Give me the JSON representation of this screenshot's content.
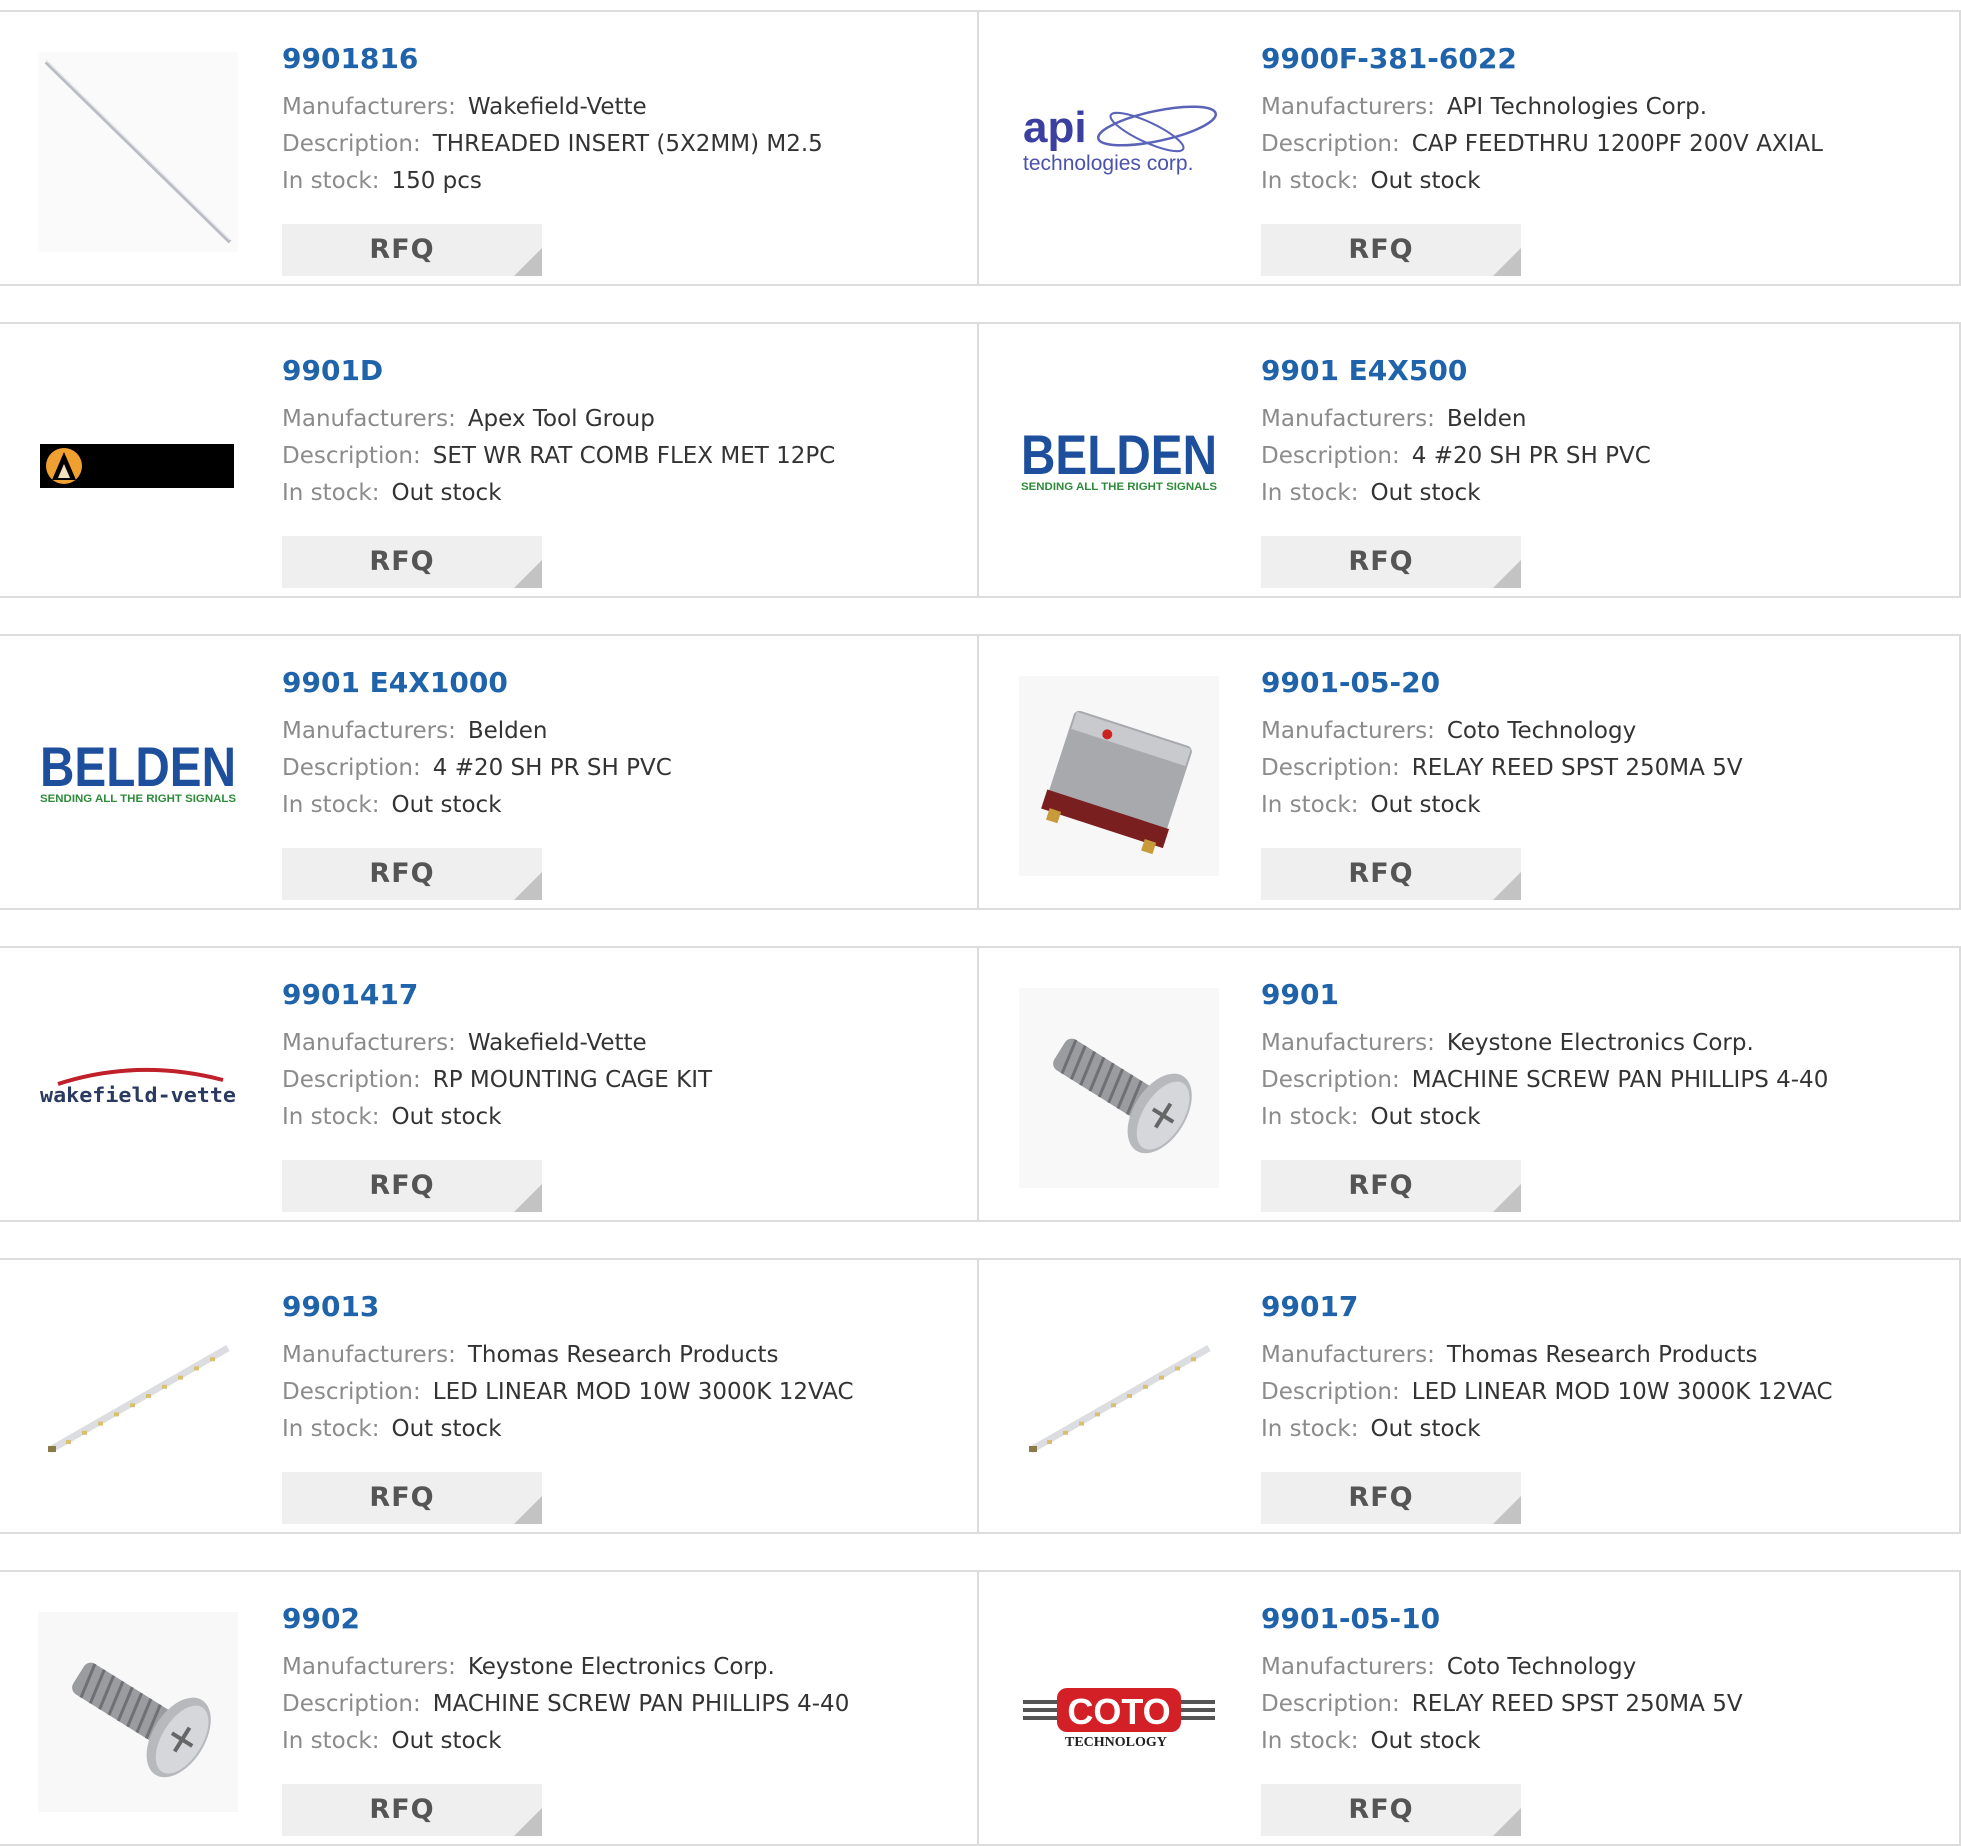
{
  "labels": {
    "manufacturers": "Manufacturers:",
    "description": "Description:",
    "in_stock": "In stock:",
    "rfq": "RFQ"
  },
  "colors": {
    "part_link": "#1f63aa",
    "label_gray": "#8b8b8b",
    "button_bg": "#efefef",
    "belden_blue": "#1d4f9c",
    "belden_green": "#2e8b3a",
    "api_blue": "#3a3fa0",
    "wakefield_red": "#c0202a",
    "coto_red": "#d31f26"
  },
  "rows": [
    {
      "left": {
        "part": "9901816",
        "manufacturer": "Wakefield-Vette",
        "description": "THREADED INSERT (5X2MM) M2.5",
        "stock": "150 pcs",
        "image": "threaded-rod-image"
      },
      "right": {
        "part": "9900F-381-6022",
        "manufacturer": "API Technologies Corp.",
        "description": "CAP FEEDTHRU 1200PF 200V AXIAL",
        "stock": "Out stock",
        "image": "api-logo",
        "logo_line1": "api",
        "logo_line2": "technologies corp."
      }
    },
    {
      "left": {
        "part": "9901D",
        "manufacturer": "Apex Tool Group",
        "description": "SET WR RAT COMB FLEX MET 12PC",
        "stock": "Out stock",
        "image": "apex-logo"
      },
      "right": {
        "part": "9901 E4X500",
        "manufacturer": "Belden",
        "description": "4 #20 SH PR SH PVC",
        "stock": "Out stock",
        "image": "belden-logo",
        "logo_line1": "BELDEN",
        "logo_line2": "SENDING ALL THE RIGHT SIGNALS"
      }
    },
    {
      "left": {
        "part": "9901 E4X1000",
        "manufacturer": "Belden",
        "description": "4 #20 SH PR SH PVC",
        "stock": "Out stock",
        "image": "belden-logo",
        "logo_line1": "BELDEN",
        "logo_line2": "SENDING ALL THE RIGHT SIGNALS"
      },
      "right": {
        "part": "9901-05-20",
        "manufacturer": "Coto Technology",
        "description": "RELAY REED SPST 250MA 5V",
        "stock": "Out stock",
        "image": "relay-image"
      }
    },
    {
      "left": {
        "part": "9901417",
        "manufacturer": "Wakefield-Vette",
        "description": "RP MOUNTING CAGE KIT",
        "stock": "Out stock",
        "image": "wakefield-logo",
        "logo_line1": "wakefield-vette"
      },
      "right": {
        "part": "9901",
        "manufacturer": "Keystone Electronics Corp.",
        "description": "MACHINE SCREW PAN PHILLIPS 4-40",
        "stock": "Out stock",
        "image": "screw-image"
      }
    },
    {
      "left": {
        "part": "99013",
        "manufacturer": "Thomas Research Products",
        "description": "LED LINEAR MOD 10W 3000K 12VAC",
        "stock": "Out stock",
        "image": "led-strip-image"
      },
      "right": {
        "part": "99017",
        "manufacturer": "Thomas Research Products",
        "description": "LED LINEAR MOD 10W 3000K 12VAC",
        "stock": "Out stock",
        "image": "led-strip-image"
      }
    },
    {
      "left": {
        "part": "9902",
        "manufacturer": "Keystone Electronics Corp.",
        "description": "MACHINE SCREW PAN PHILLIPS 4-40",
        "stock": "Out stock",
        "image": "screw-image"
      },
      "right": {
        "part": "9901-05-10",
        "manufacturer": "Coto Technology",
        "description": "RELAY REED SPST 250MA 5V",
        "stock": "Out stock",
        "image": "coto-logo",
        "logo_line1": "COTO",
        "logo_line2": "TECHNOLOGY"
      }
    }
  ]
}
